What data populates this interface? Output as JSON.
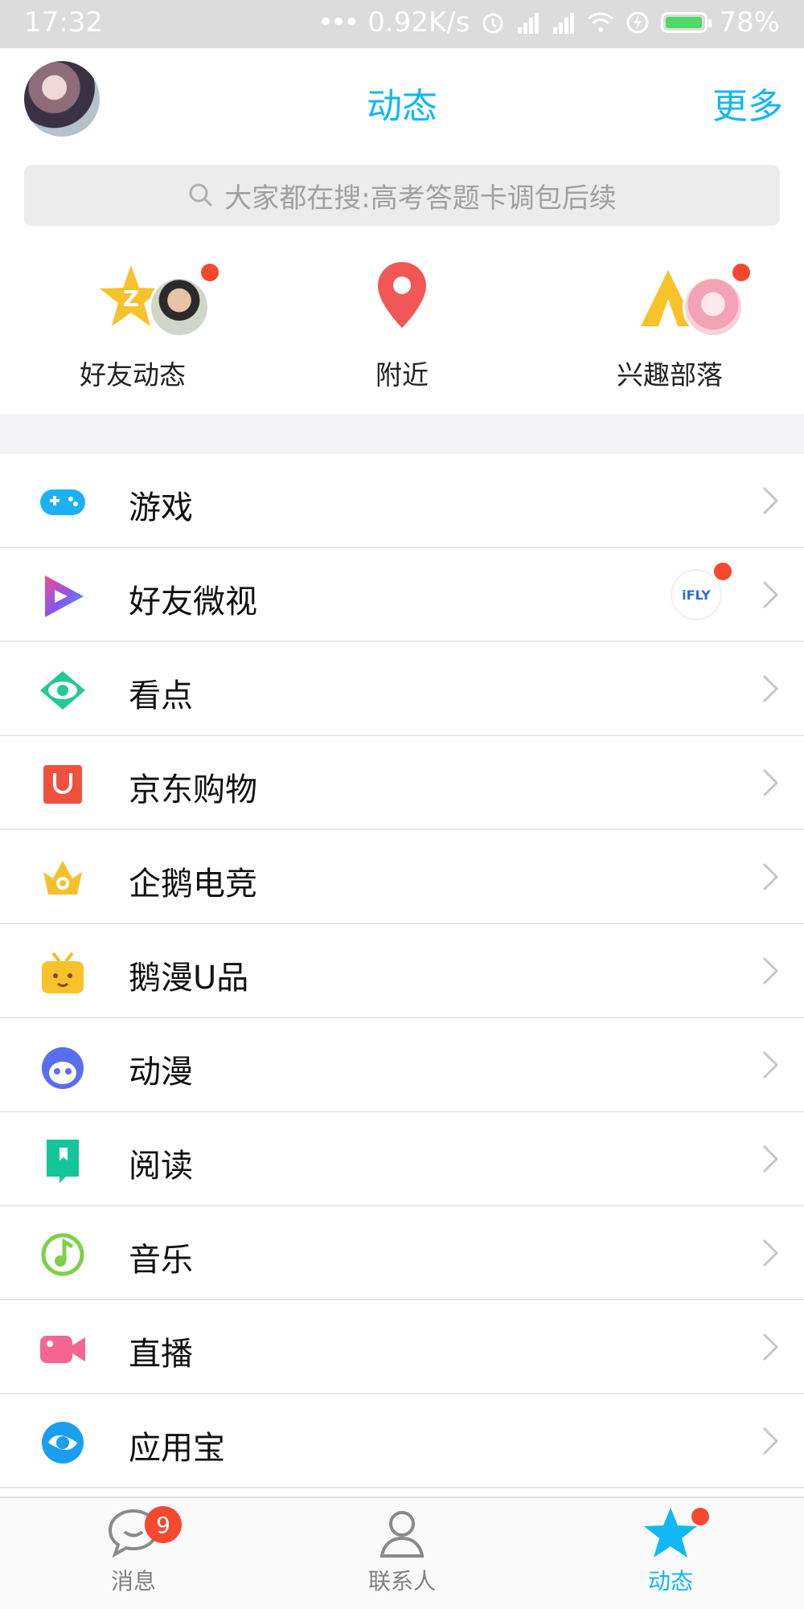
{
  "status_bar": {
    "time": "17:32",
    "speed": "0.92K/s",
    "battery": "78%",
    "battery_level": 0.78
  },
  "header": {
    "title": "动态",
    "more": "更多"
  },
  "search": {
    "placeholder": "大家都在搜:高考答题卡调包后续"
  },
  "quick_links": [
    {
      "label": "好友动态",
      "icon": "qzone-star-icon",
      "has_dot": true
    },
    {
      "label": "附近",
      "icon": "location-pin-icon",
      "has_dot": false
    },
    {
      "label": "兴趣部落",
      "icon": "tribe-tent-icon",
      "has_dot": true
    }
  ],
  "menu": [
    {
      "label": "游戏",
      "icon": "gamepad-icon"
    },
    {
      "label": "好友微视",
      "icon": "weishi-play-icon",
      "badge_text": "iFLY"
    },
    {
      "label": "看点",
      "icon": "eye-icon"
    },
    {
      "label": "京东购物",
      "icon": "jd-shopping-icon"
    },
    {
      "label": "企鹅电竞",
      "icon": "esports-crown-icon"
    },
    {
      "label": "鹅漫U品",
      "icon": "tv-face-icon"
    },
    {
      "label": "动漫",
      "icon": "anime-face-icon"
    },
    {
      "label": "阅读",
      "icon": "bookmark-icon"
    },
    {
      "label": "音乐",
      "icon": "music-note-icon"
    },
    {
      "label": "直播",
      "icon": "video-camera-icon"
    },
    {
      "label": "应用宝",
      "icon": "app-store-icon"
    }
  ],
  "tabbar": {
    "tabs": [
      {
        "label": "消息",
        "icon": "chat-bubble-icon",
        "badge": "9"
      },
      {
        "label": "联系人",
        "icon": "contact-person-icon"
      },
      {
        "label": "动态",
        "icon": "star-icon",
        "active": true
      }
    ]
  },
  "colors": {
    "accent": "#12b7f5",
    "red_dot": "#f5482f"
  }
}
